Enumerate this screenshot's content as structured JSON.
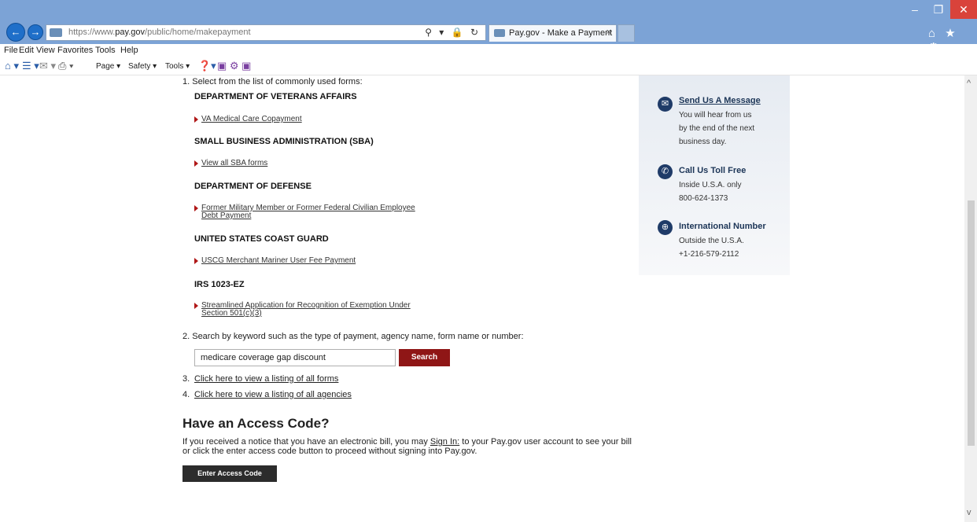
{
  "browser": {
    "url_prefix": "https://www.",
    "url_domain": "pay.gov",
    "url_path": "/public/home/makepayment",
    "addr_tools": "⚲ ▾ 🔒 ↻",
    "tab_title": "Pay.gov - Make a Payment",
    "tab_close": "×",
    "back_glyph": "←",
    "fwd_glyph": "→",
    "min_glyph": "–",
    "max_glyph": "❐",
    "close_glyph": "✕",
    "right_icons": "⌂ ★ ⚙",
    "icons": [
      "back-icon",
      "forward-icon",
      "search-icon",
      "lock-icon",
      "refresh-icon",
      "home-icon",
      "favorites-star-icon",
      "gear-icon"
    ]
  },
  "menu": [
    "File",
    "Edit",
    "View",
    "Favorites",
    "Tools",
    "Help"
  ],
  "cmdbar": {
    "home_glyph": "⌂ ▾",
    "feeds_glyph": "☰ ▾",
    "mail_glyph": "✉ ▾",
    "print_glyph": "⎙ ▾",
    "page": "Page ▾",
    "safety": "Safety ▾",
    "tools": "Tools ▾",
    "help_glyph": "❓▾",
    "misc_glyph": "▣ ⚙ ▣"
  },
  "forms": {
    "step1": "1.  Select from the list of commonly used forms:",
    "agencies": [
      {
        "name": "DEPARTMENT OF VETERANS AFFAIRS",
        "link": "VA Medical Care Copayment"
      },
      {
        "name": "SMALL BUSINESS ADMINISTRATION (SBA)",
        "link": "View all SBA forms"
      },
      {
        "name": "DEPARTMENT OF DEFENSE",
        "link": "Former Military Member or Former Federal Civilian Employee Debt Payment"
      },
      {
        "name": "UNITED STATES COAST GUARD",
        "link": "USCG Merchant Mariner User Fee Payment"
      },
      {
        "name": "IRS 1023-EZ",
        "link": "Streamlined Application for Recognition of Exemption Under Section 501(c)(3)"
      }
    ],
    "step2": "2.  Search by keyword such as the type of payment, agency name, form name or number:",
    "search_value": "medicare coverage gap discount",
    "search_button": "Search",
    "step3_num": "3.",
    "step3_link": "Click here to view a listing of all forms",
    "step4_num": "4.",
    "step4_link": "Click here to view a listing of all agencies"
  },
  "access": {
    "heading": "Have an Access Code?",
    "text_before": "If you received a notice that you have an electronic bill, you may ",
    "sign_in": "Sign In:",
    "text_after": " to your Pay.gov user account to see your bill or click the enter access code button to proceed without signing into Pay.gov.",
    "button": "Enter Access Code"
  },
  "sidebar": {
    "message": {
      "head": "Send Us A Message",
      "line1": "You will hear from us",
      "line2": "by the end of the next",
      "line3": "business day.",
      "icon": "envelope-icon",
      "glyph": "✉"
    },
    "toll_free": {
      "head": "Call Us Toll Free",
      "line1": "Inside U.S.A. only",
      "line2": "800-624-1373",
      "icon": "phone-icon",
      "glyph": "✆"
    },
    "international": {
      "head": "International Number",
      "line1": "Outside the U.S.A.",
      "line2": "+1-216-579-2112",
      "icon": "globe-icon",
      "glyph": "⊕"
    }
  },
  "scroll": {
    "up": "^",
    "down": "v"
  }
}
